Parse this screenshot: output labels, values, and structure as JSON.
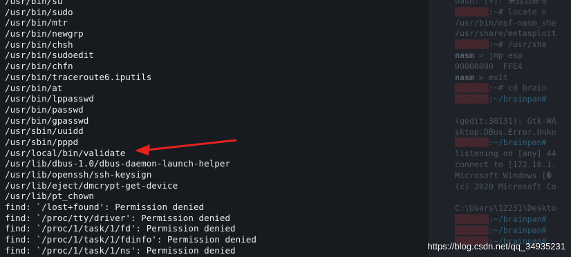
{
  "left_lines": [
    "/usr/bin/su",
    "/usr/bin/sudo",
    "/usr/bin/mtr",
    "/usr/bin/newgrp",
    "/usr/bin/chsh",
    "/usr/bin/sudoedit",
    "/usr/bin/chfn",
    "/usr/bin/traceroute6.iputils",
    "/usr/bin/at",
    "/usr/bin/lppasswd",
    "/usr/bin/passwd",
    "/usr/bin/gpasswd",
    "/usr/sbin/uuidd",
    "/usr/sbin/pppd",
    "/usr/local/bin/validate",
    "/usr/lib/dbus-1.0/dbus-daemon-launch-helper",
    "/usr/lib/openssh/ssh-keysign",
    "/usr/lib/eject/dmcrypt-get-device",
    "/usr/lib/pt_chown",
    "find: `/lost+found': Permission denied",
    "find: `/proc/tty/driver': Permission denied",
    "find: `/proc/1/task/1/fd': Permission denied",
    "find: `/proc/1/task/1/fdinfo': Permission denied",
    "find: `/proc/1/task/1/ns': Permission denied"
  ],
  "right_lines": [
    {
      "prefix": "",
      "text": "bash: [+]: 未找到命令"
    },
    {
      "prefix": "",
      "text": ":~# locate n"
    },
    {
      "prefix": "",
      "text": "/usr/bin/msf-nasm_she"
    },
    {
      "prefix": "",
      "text": "/usr/share/metasploit"
    },
    {
      "prefix": "",
      "text": ":~# /usr/sha"
    },
    {
      "prefix": "nasm",
      "text": " > jmp esp"
    },
    {
      "prefix": "",
      "text": "00000000  FFE4"
    },
    {
      "prefix": "nasm",
      "text": " > exit"
    },
    {
      "prefix": "",
      "text": ":~# cd brain"
    },
    {
      "prefix": "",
      "text": ":~/brainpan#"
    },
    {
      "prefix": "",
      "text": ""
    },
    {
      "prefix": "",
      "text": "(gedit:30131): Gtk-WA"
    },
    {
      "prefix": "",
      "text": "sktop.DBus.Error.Unkn"
    },
    {
      "prefix": "",
      "text": ":~/brainpan#"
    },
    {
      "prefix": "",
      "text": "listening on [any] 44"
    },
    {
      "prefix": "",
      "text": "connect to [172.16.1."
    },
    {
      "prefix": "",
      "text": "Microsoft Windows [�"
    },
    {
      "prefix": "",
      "text": "(c) 2020 Microsoft Co"
    },
    {
      "prefix": "",
      "text": ""
    },
    {
      "prefix": "",
      "text": "C:\\Users\\12231\\Deskto"
    },
    {
      "prefix": "",
      "text": ":~/brainpan#"
    },
    {
      "prefix": "",
      "text": ":~/brainpan#"
    },
    {
      "prefix": "",
      "text": ":~/brainpan#"
    }
  ],
  "watermark": "https://blog.csdn.net/qq_34935231",
  "colors": {
    "background": "#171a1f",
    "text": "#e9ecef",
    "arrow": "#e8221f"
  }
}
